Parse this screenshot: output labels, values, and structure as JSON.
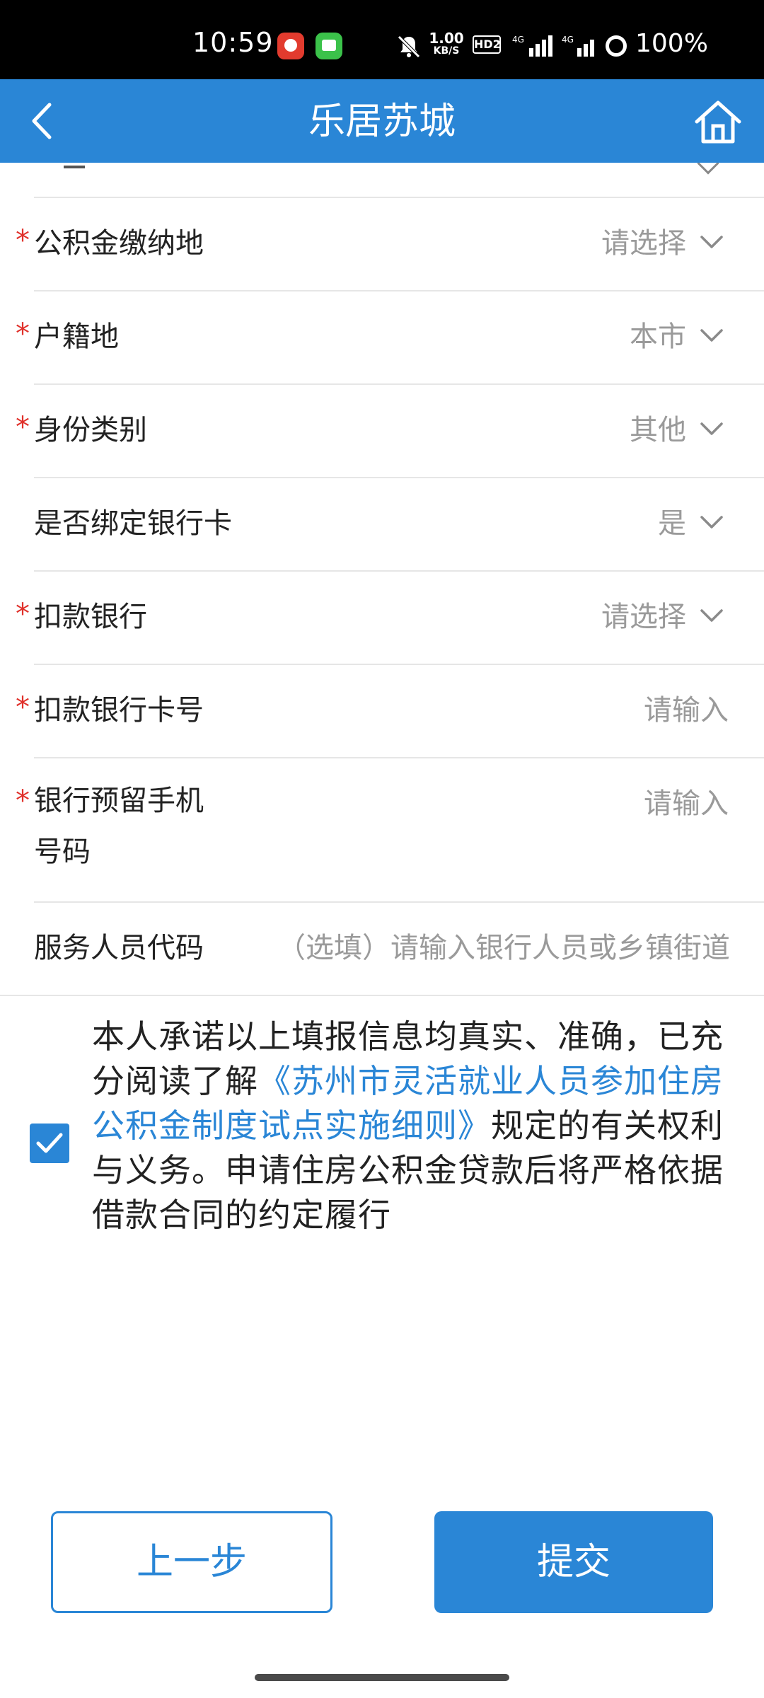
{
  "status_bar": {
    "time": "10:59",
    "net_speed": "1.00",
    "net_speed_unit": "KB/S",
    "hd_label": "HD2",
    "signal1": "4G",
    "signal2": "4G",
    "battery": "100%"
  },
  "header": {
    "title": "乐居苏城",
    "back_icon": "chevron-left-icon",
    "home_icon": "home-icon"
  },
  "form": {
    "rows": [
      {
        "label": "公积金缴纳地",
        "value": "请选择",
        "required": true,
        "type": "select"
      },
      {
        "label": "户籍地",
        "value": "本市",
        "required": true,
        "type": "select"
      },
      {
        "label": "身份类别",
        "value": "其他",
        "required": true,
        "type": "select"
      },
      {
        "label": "是否绑定银行卡",
        "value": "是",
        "required": false,
        "type": "select"
      },
      {
        "label": "扣款银行",
        "value": "请选择",
        "required": true,
        "type": "select"
      },
      {
        "label": "扣款银行卡号",
        "placeholder": "请输入",
        "required": true,
        "type": "input"
      },
      {
        "label": "银行预留手机号码",
        "placeholder": "请输入",
        "required": true,
        "type": "input"
      },
      {
        "label": "服务人员代码",
        "placeholder": "（选填）请输入银行人员或乡镇街道",
        "required": false,
        "type": "input"
      }
    ],
    "required_mark": "*"
  },
  "consent": {
    "checked": true,
    "text_before": "本人承诺以上填报信息均真实、准确，已充分阅读了解",
    "link_text": "《苏州市灵活就业人员参加住房公积金制度试点实施细则》",
    "text_after": "规定的有关权利与义务。申请住房公积金贷款后将严格依据借款合同的约定履行"
  },
  "buttons": {
    "prev": "上一步",
    "submit": "提交"
  },
  "colors": {
    "primary": "#2a86d6",
    "required": "#e0312b",
    "placeholder": "#9a9a9a"
  }
}
